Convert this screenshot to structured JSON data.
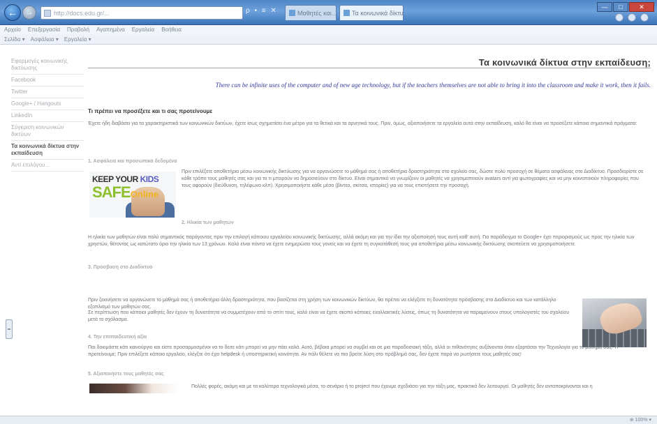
{
  "browser": {
    "address": "http://docs.edu.gr/...",
    "address_controls": "ρ • ≡ ✕",
    "tabs": [
      {
        "label": "Μαθητές και..."
      },
      {
        "label": "Τα κοινωνικά δίκτυα... ×"
      }
    ],
    "menu": [
      "Αρχείο",
      "Επεξεργασία",
      "Προβολή",
      "Αγαπημένα",
      "Εργαλεία",
      "Βοήθεια"
    ],
    "commands": [
      "Σελίδα ▾",
      "Ασφάλεια ▾",
      "Εργαλεία ▾"
    ],
    "zoom": "⊕ 100% ▾"
  },
  "sidebar": {
    "items": [
      {
        "label": "Εφαρμογές κοινωνικής δικτύωσης"
      },
      {
        "label": "Facebook"
      },
      {
        "label": "Twitter"
      },
      {
        "label": "Google+ / Hangouts"
      },
      {
        "label": "LinkedIn"
      },
      {
        "label": "Σύγκριση κοινωνικών δικτύων"
      },
      {
        "label": "Τα κοινωνικά δίκτυα στην εκπαίδευση"
      },
      {
        "label": "Αντί επιλόγου..."
      }
    ],
    "active_index": 6
  },
  "main": {
    "title": "Τα κοινωνικά δίκτυα στην εκπαίδευση;",
    "quote": "There can be infinite uses of the computer and of new age technology, but if the teachers themselves are not able to bring it into the classroom and make it work, then it fails.",
    "heading": "Τι πρέπει να προσέξετε και τι σας προτείνουμε",
    "intro": "Έχετε ήδη διαβάσει για τα χαρακτηριστικά των κοινωνικών δικτύων, έχετε ίσως σχηματίσει ένα μέτρο για τα θετικά και τα αρνητικά τους. Πριν, όμως, αξιοποιήσετε τα εργαλεία αυτά στην εκπαίδευση, καλό θα είναι να προσέξετε κάποια σημαντικά πράγματα:",
    "sections": [
      {
        "title": "1. Ασφάλεια και προσωπικά δεδομένα",
        "text": "Πριν επιλέξετε αποθετήρια μέσω κοινωνικής δικτύωσης για να οργανώσετε το μάθημά σας ή αποθετήρια δραστηριότητα στο σχολείο σας, δώστε πολύ προσοχή σε θέματα ασφάλειας στο Διαδίκτυο. Προσδιορίστε σε κάθε τρόπο τους μαθητές σας και για το τι μπορούν να δημοσιεύουν στο δίκτυο. Είναι σημαντικό να γνωρίζουν οι μαθητές να χρησιμοποιούν avatars αντί για φωτογραφίες και να μην κοινοποιούν πληροφορίες που τους αφορούν (διεύθυνση, τηλέφωνο κλπ). Χρησιμοποιήστε κάθε μέσο (βίντεο, σκίτσα, ιστορίες) για να τους επιστήσετε την προσοχή."
      },
      {
        "title": "2. Ηλικία των μαθητών",
        "text": "Η ηλικία των μαθητών είναι πολύ σημαντικός παράγοντας πριν την επιλογή κάποιου εργαλείου κοινωνικής δικτύωσης, αλλά ακόμη και για την ίδια την αξιοποίησή τους αυτή καθ' αυτή. Για παράδειγμα το Google+ έχει περιορισμούς ως προς την ηλικία των χρηστών, θέτοντας ως κατώτατο όριο την ηλικία των 13 χρόνων. Καλό είναι πάντα να έχετε ενημερώσει τους γονείς και να έχετε τη συγκατάθεσή τους για αποθετήρια μέσω κοινωνικής δικτύωσης σκοπεύετε να χρησιμοποιήσετε."
      },
      {
        "title": "3. Πρόσβαση στο Διαδίκτυο",
        "text": "Πριν ξεκινήσετε να οργανώνετε το μάθημά σας ή αποθετήρια άλλη δραστηριότητα, που βασίζεται στη χρήση των κοινωνικών δικτύων, θα πρέπει να ελέγξετε τη δυνατότητα πρόσβασης στο Διαδίκτυο και των κατάλληλο εξοπλισμό των μαθητών σας.",
        "text2": "Σε περίπτωση που κάποιοι μαθητές δεν έχουν τη δυνατότητα να συμμετέχουν από το σπίτι τους, καλό είναι να έχετε σκοπό κάποιες εναλλακτικές λύσεις, όπως τη δυνατότητα να παραμείνουν στους υπολογιστές του σχολείου μετά το σχόλασμα."
      },
      {
        "title": "4. Την επιπαιδευτική αξία",
        "text": "Παι δοκιμάστε κάτι καινούργιο και είστε προσαρμοσμένοι να το δειτε κάτι μπορεί να μην πάει καλά. Αυτό, βέβαια μπορεί να συμβεί και σε μια παραδοσιακή τάξη, αλλά οι πιθανότητες αυξάνονται όταν εξαρτάσαι την Τεχνολογία για το μάθημά σας. Τι προτείνουμε; Πριν επιλέξετε κάποιο εργαλείο, ελέγξτε ότι έχει helpdesk ή υποστηρικτική κοινότητα. Αν πάλι θέλετε να πιο βρείτε λύση στο πρόβλημά σας, δεν έχετε παρά να ρωτήσετε τους μαθητές σας!"
      },
      {
        "title": "5. Αξιοποιήστε τους μαθητές σας",
        "text": "Πολλές φορές, ακόμη και με τα καλύτερα τεχνολογικά μέσα, το σενάριο ή το project που έχουμε σχεδιάσει για την τάξη μας, πρακτικά δεν λειτουργεί. Οι μαθητές δεν ανταποκρίνονται και η"
      }
    ],
    "image_caption": {
      "line1_a": "KEEP YOUR ",
      "line1_b": "KIDS",
      "line2_a": "SAFE",
      "line2_b": "Online"
    }
  }
}
